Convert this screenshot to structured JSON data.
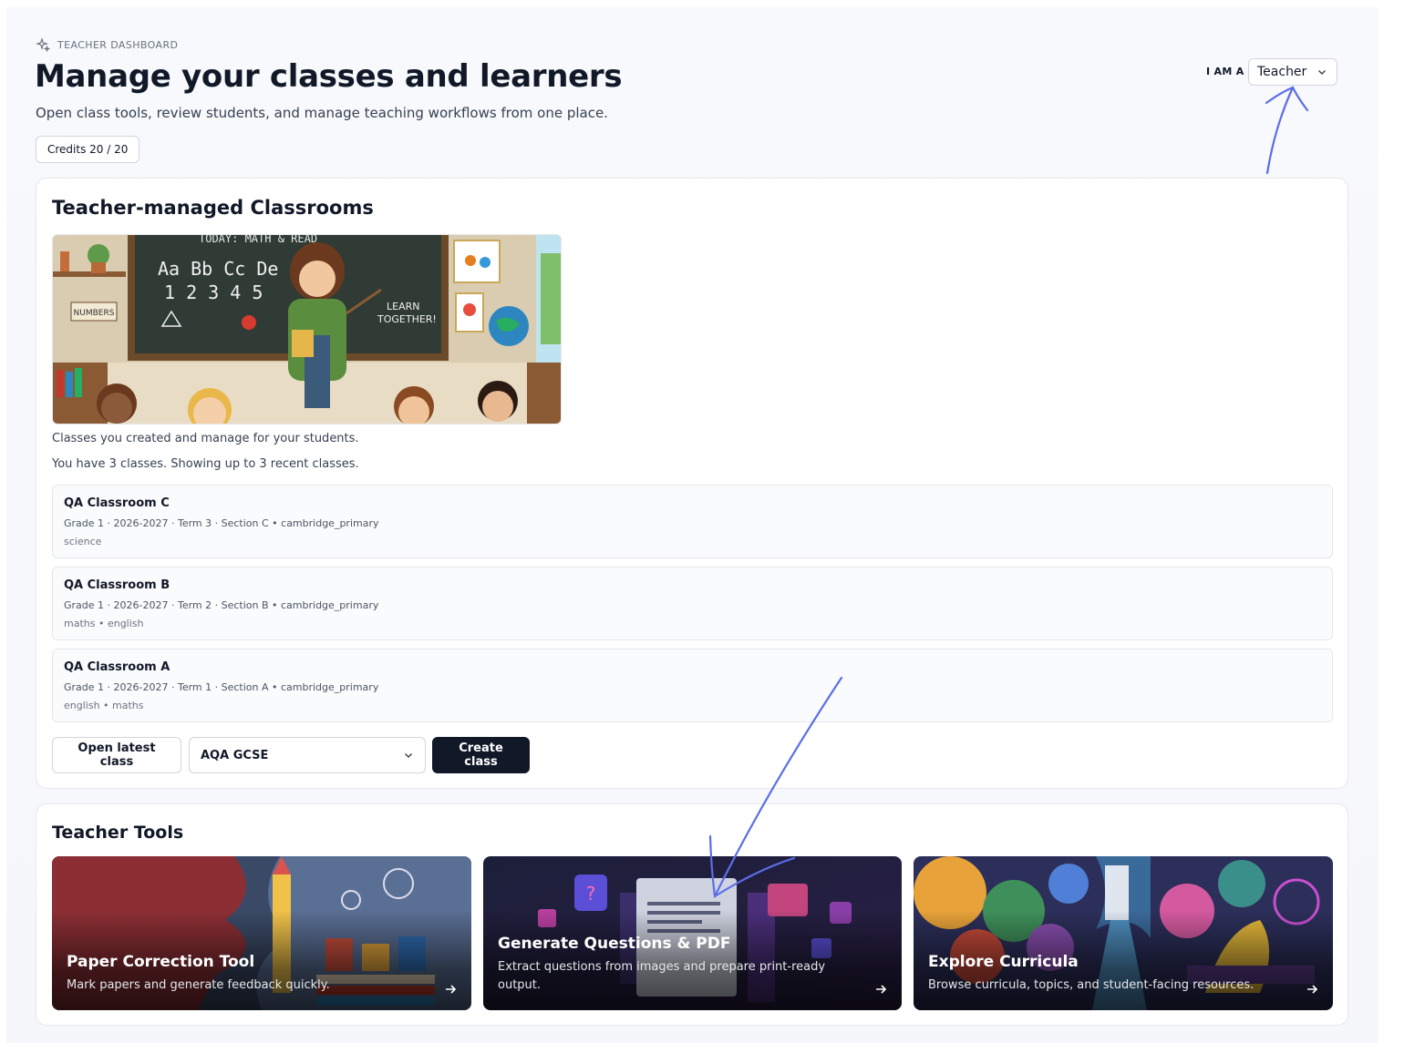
{
  "header": {
    "eyebrow": "TEACHER DASHBOARD",
    "title": "Manage your classes and learners",
    "subtitle": "Open class tools, review students, and manage teaching workflows from one place.",
    "credits": "Credits 20 / 20",
    "role_label": "I AM A",
    "role_value": "Teacher"
  },
  "classrooms": {
    "title": "Teacher-managed Classrooms",
    "description": "Classes you created and manage for your students.",
    "count_text": "You have 3 classes. Showing up to 3 recent classes.",
    "items": [
      {
        "name": "QA Classroom C",
        "meta": "Grade 1 · 2026-2027 · Term 3 · Section C • cambridge_primary",
        "subjects": "science"
      },
      {
        "name": "QA Classroom B",
        "meta": "Grade 1 · 2026-2027 · Term 2 · Section B • cambridge_primary",
        "subjects": "maths • english"
      },
      {
        "name": "QA Classroom A",
        "meta": "Grade 1 · 2026-2027 · Term 1 · Section A • cambridge_primary",
        "subjects": "english • maths"
      }
    ],
    "open_latest_label": "Open latest class",
    "curriculum_value": "AQA GCSE",
    "create_label": "Create class",
    "illustration_text": {
      "board_top": "TODAY: MATH & READ",
      "letters": "Aa Bb Cc De",
      "numbers": "1 2 3 4 5",
      "learn": "LEARN",
      "together": "TOGETHER!",
      "numbers_sign": "NUMBERS"
    }
  },
  "tools": {
    "title": "Teacher Tools",
    "items": [
      {
        "title": "Paper Correction Tool",
        "desc": "Mark papers and generate feedback quickly."
      },
      {
        "title": "Generate Questions & PDF",
        "desc": "Extract questions from images and prepare print-ready output."
      },
      {
        "title": "Explore Curricula",
        "desc": "Browse curricula, topics, and student-facing resources."
      }
    ]
  },
  "colors": {
    "primary_dark": "#111827",
    "annotation_arrow": "#5b6ee8",
    "border": "#e5e7eb"
  }
}
